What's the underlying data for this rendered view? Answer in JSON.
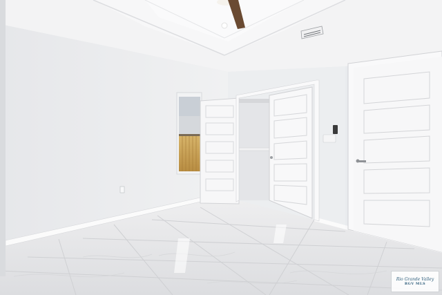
{
  "photo": {
    "subject": "Empty bedroom interior",
    "colors": {
      "wall": "#ecedef",
      "wall_shadow": "#dfe1e4",
      "ceiling": "#f4f4f5",
      "floor": "#e7e7e9",
      "floor_vein": "#c9cacd",
      "door": "#f7f7f8",
      "trim": "#f9f9fa",
      "fence": "#c9a25a",
      "fan_blade": "#6a4a32"
    }
  },
  "watermark": {
    "logo_text": "Rio Grande Valley",
    "sub_text": "RGV MLS"
  }
}
